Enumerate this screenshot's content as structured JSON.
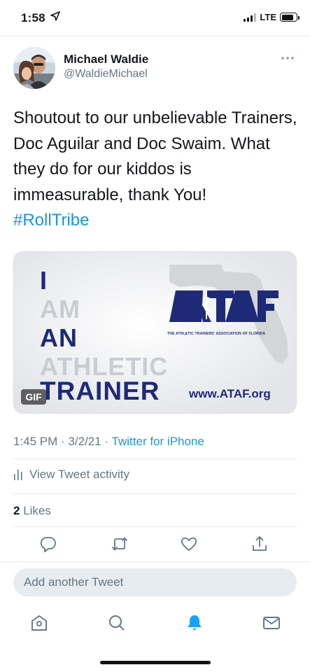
{
  "status_bar": {
    "time": "1:58",
    "network": "LTE",
    "battery_level": 0.8,
    "icons": [
      "location-arrow-icon",
      "signal-icon",
      "battery-icon"
    ]
  },
  "tweet": {
    "author_name": "Michael Waldie",
    "author_handle": "@WaldieMichael",
    "text": "Shoutout to our unbelievable Trainers, Doc Aguilar and Doc Swaim.  What they do for our kiddos is immeasurable, thank You!",
    "hashtag": "#RollTribe",
    "media": {
      "badge": "GIF",
      "lines": [
        "I",
        "AM",
        "AN",
        "ATHLETIC",
        "TRAINER"
      ],
      "logo_text": "ATAF",
      "logo_subtitle": "THE ATHLETIC TRAINERS' ASSOCIATION OF FLORIDA",
      "url": "www.ATAF.org"
    },
    "time": "1:45 PM",
    "date": "3/2/21",
    "separator": "·",
    "source": "Twitter for iPhone",
    "activity_label": "View Tweet activity",
    "likes_count": "2",
    "likes_label": "Likes"
  },
  "actions": [
    "reply-icon",
    "retweet-icon",
    "like-icon",
    "share-icon"
  ],
  "compose": {
    "placeholder": "Add another Tweet"
  },
  "tabs": [
    "home-icon",
    "search-icon",
    "notifications-icon",
    "messages-icon"
  ],
  "colors": {
    "link": "#1b95e0",
    "secondary_text": "#657786",
    "divider": "#e6ecf0",
    "ataf_blue": "#1e2a78"
  }
}
